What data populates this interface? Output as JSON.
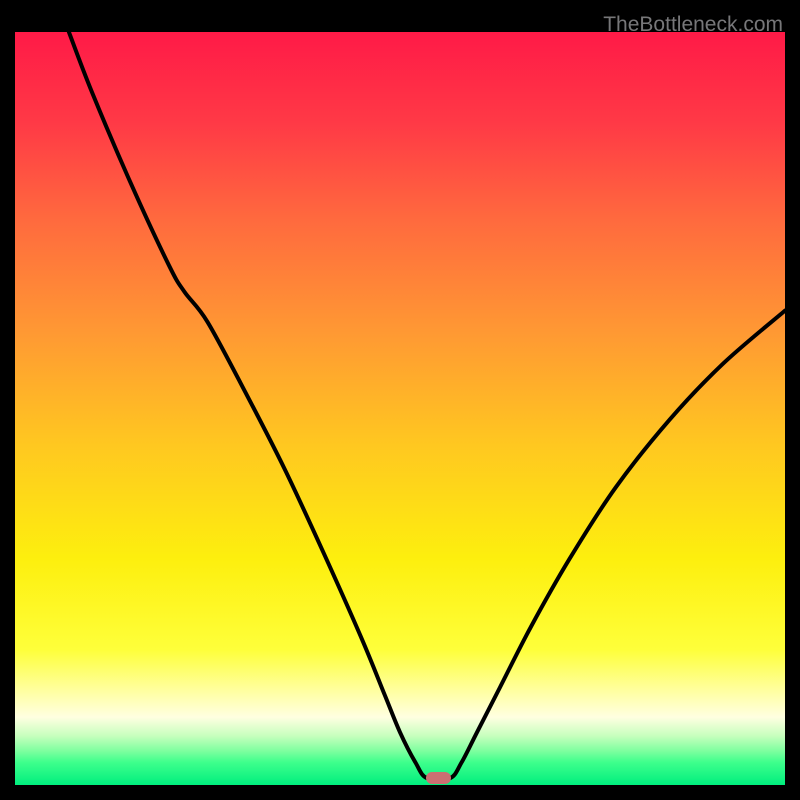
{
  "watermark": "TheBottleneck.com",
  "chart_data": {
    "type": "line",
    "title": "",
    "xlabel": "",
    "ylabel": "",
    "xlim": [
      0,
      100
    ],
    "ylim": [
      0,
      100
    ],
    "gradient_stops": [
      {
        "offset": 0,
        "color": "#ff1a47"
      },
      {
        "offset": 12,
        "color": "#ff3946"
      },
      {
        "offset": 25,
        "color": "#ff6a3e"
      },
      {
        "offset": 40,
        "color": "#ff9933"
      },
      {
        "offset": 55,
        "color": "#ffc820"
      },
      {
        "offset": 70,
        "color": "#fdef0e"
      },
      {
        "offset": 82,
        "color": "#feff3a"
      },
      {
        "offset": 88,
        "color": "#ffffaa"
      },
      {
        "offset": 91,
        "color": "#ffffe1"
      },
      {
        "offset": 93.5,
        "color": "#c6ffbd"
      },
      {
        "offset": 95.5,
        "color": "#7dff9f"
      },
      {
        "offset": 97,
        "color": "#3eff8c"
      },
      {
        "offset": 100,
        "color": "#00ee7e"
      }
    ],
    "series": [
      {
        "name": "bottleneck-curve",
        "points": [
          {
            "x": 7.0,
            "y": 100.0
          },
          {
            "x": 10.0,
            "y": 92.0
          },
          {
            "x": 15.0,
            "y": 80.0
          },
          {
            "x": 20.0,
            "y": 69.0
          },
          {
            "x": 22.0,
            "y": 65.5
          },
          {
            "x": 25.0,
            "y": 61.5
          },
          {
            "x": 30.0,
            "y": 52.0
          },
          {
            "x": 35.0,
            "y": 42.0
          },
          {
            "x": 40.0,
            "y": 31.0
          },
          {
            "x": 45.0,
            "y": 19.5
          },
          {
            "x": 48.0,
            "y": 12.0
          },
          {
            "x": 50.0,
            "y": 7.0
          },
          {
            "x": 52.0,
            "y": 3.0
          },
          {
            "x": 53.5,
            "y": 0.9
          },
          {
            "x": 56.5,
            "y": 0.9
          },
          {
            "x": 58.0,
            "y": 3.0
          },
          {
            "x": 60.0,
            "y": 7.0
          },
          {
            "x": 63.0,
            "y": 13.0
          },
          {
            "x": 67.0,
            "y": 21.0
          },
          {
            "x": 72.0,
            "y": 30.0
          },
          {
            "x": 78.0,
            "y": 39.5
          },
          {
            "x": 85.0,
            "y": 48.5
          },
          {
            "x": 92.0,
            "y": 56.0
          },
          {
            "x": 100.0,
            "y": 63.0
          }
        ]
      }
    ],
    "marker": {
      "x": 55.0,
      "y": 0.9,
      "width": 3.2,
      "height": 1.6
    }
  }
}
